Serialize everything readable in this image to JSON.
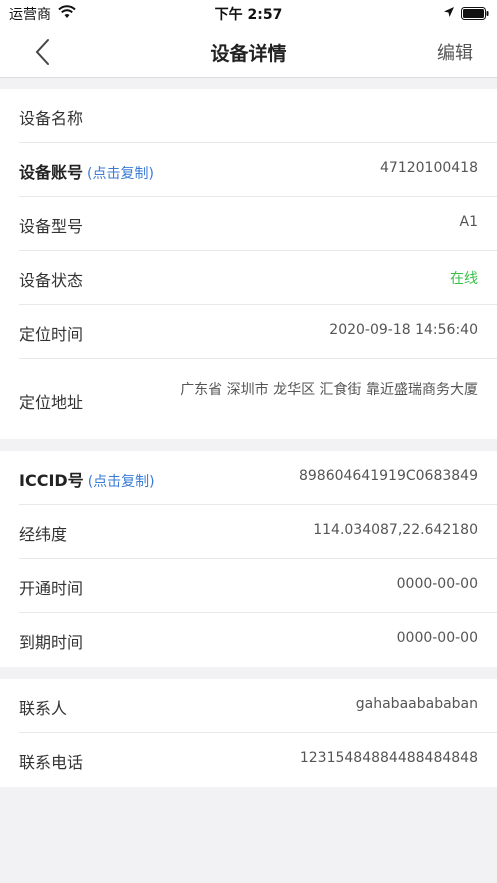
{
  "status": {
    "carrier": "运营商",
    "time": "下午 2:57"
  },
  "nav": {
    "title": "设备详情",
    "edit": "编辑"
  },
  "group1": [
    {
      "label": "设备名称",
      "value": ""
    },
    {
      "label": "设备账号",
      "copy": "(点击复制)",
      "value": "47120100418"
    },
    {
      "label": "设备型号",
      "value": "A1"
    },
    {
      "label": "设备状态",
      "value": "在线"
    },
    {
      "label": "定位时间",
      "value": "2020-09-18 14:56:40"
    },
    {
      "label": "定位地址",
      "value": "广东省 深圳市 龙华区 汇食街 靠近盛瑞商务大厦"
    }
  ],
  "group2": [
    {
      "label": "ICCID号",
      "copy": "(点击复制)",
      "value": "898604641919C0683849"
    },
    {
      "label": "经纬度",
      "value": "114.034087,22.642180"
    },
    {
      "label": "开通时间",
      "value": "0000-00-00"
    },
    {
      "label": "到期时间",
      "value": "0000-00-00"
    }
  ],
  "group3": [
    {
      "label": "联系人",
      "value": "gahabaabababan"
    },
    {
      "label": "联系电话",
      "value": "12315484884488484848"
    }
  ],
  "colors": {
    "online": "#3cbf4a",
    "link": "#3a7bd5"
  }
}
